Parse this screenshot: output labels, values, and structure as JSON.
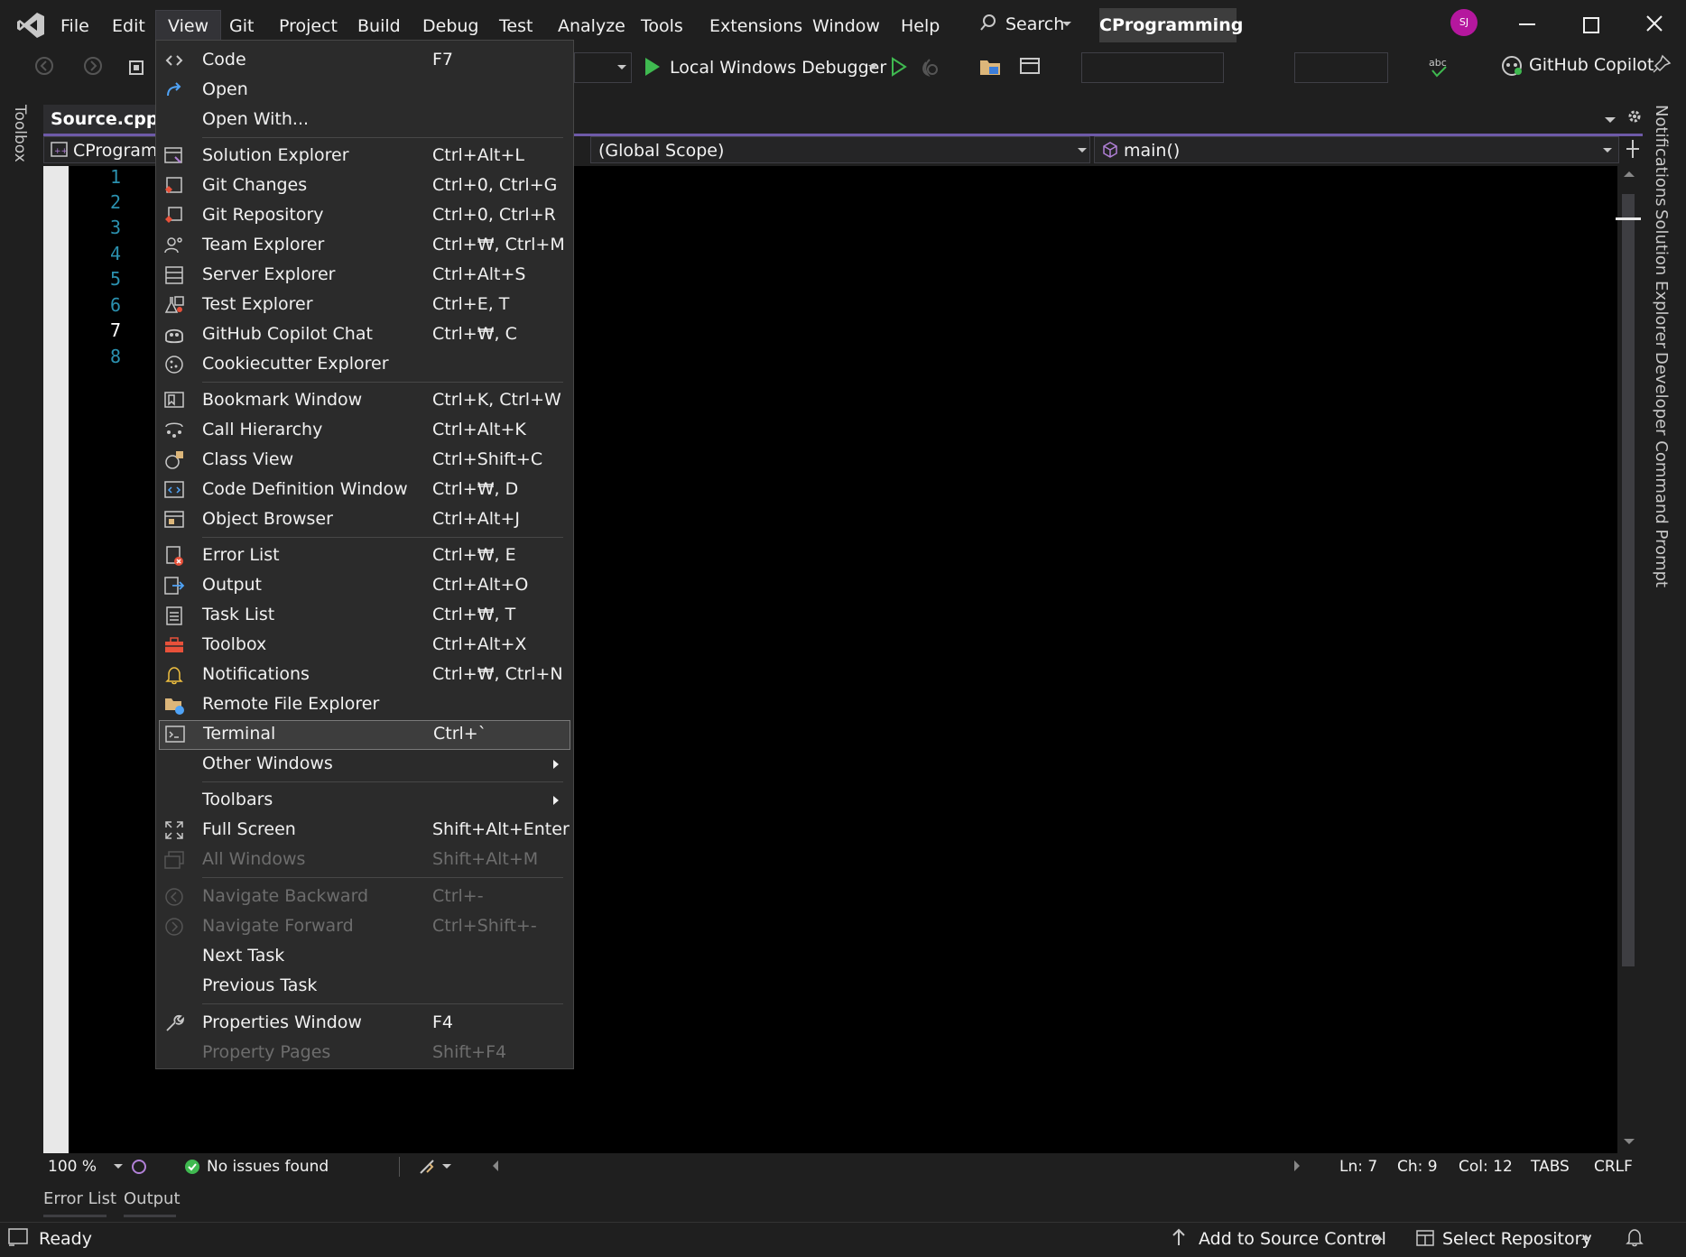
{
  "menubar": {
    "items": [
      "File",
      "Edit",
      "View",
      "Git",
      "Project",
      "Build",
      "Debug",
      "Test",
      "Analyze",
      "Tools",
      "Extensions",
      "Window",
      "Help"
    ],
    "search_label": "Search",
    "solution_name": "CProgramming",
    "avatar_initials": "SJ"
  },
  "toolbar": {
    "debugger_label": "Local Windows Debugger",
    "copilot_label": "GitHub Copilot"
  },
  "toolbox_label": "Toolbox",
  "right_panels": [
    "Notifications",
    "Solution Explorer",
    "Developer Command Prompt"
  ],
  "editor": {
    "tab_label": "Source.cpp",
    "project_combo": "CProgramm",
    "scope_combo": "(Global Scope)",
    "member_combo": "main()",
    "line_numbers": [
      "1",
      "2",
      "3",
      "4",
      "5",
      "6",
      "7",
      "8"
    ],
    "zoom": "100 %",
    "issues": "No issues found",
    "ln": "Ln: 7",
    "ch": "Ch: 9",
    "col": "Col: 12",
    "tabs": "TABS",
    "eol": "CRLF"
  },
  "bottom_tabs": [
    "Error List",
    "Output"
  ],
  "statusbar": {
    "ready": "Ready",
    "add_source_control": "Add to Source Control",
    "select_repository": "Select Repository"
  },
  "view_menu": {
    "items": [
      {
        "label": "Code",
        "shortcut": "F7",
        "icon": "code-icon"
      },
      {
        "label": "Open",
        "shortcut": "",
        "icon": "open-icon"
      },
      {
        "label": "Open With...",
        "shortcut": "",
        "icon": ""
      },
      {
        "label": "Solution Explorer",
        "shortcut": "Ctrl+Alt+L",
        "icon": "solution-explorer-icon"
      },
      {
        "label": "Git Changes",
        "shortcut": "Ctrl+0, Ctrl+G",
        "icon": "git-changes-icon"
      },
      {
        "label": "Git Repository",
        "shortcut": "Ctrl+0, Ctrl+R",
        "icon": "git-repository-icon"
      },
      {
        "label": "Team Explorer",
        "shortcut": "Ctrl+₩, Ctrl+M",
        "icon": "team-explorer-icon"
      },
      {
        "label": "Server Explorer",
        "shortcut": "Ctrl+Alt+S",
        "icon": "server-explorer-icon"
      },
      {
        "label": "Test Explorer",
        "shortcut": "Ctrl+E, T",
        "icon": "test-explorer-icon"
      },
      {
        "label": "GitHub Copilot Chat",
        "shortcut": "Ctrl+₩, C",
        "icon": "copilot-icon"
      },
      {
        "label": "Cookiecutter Explorer",
        "shortcut": "",
        "icon": "cookie-icon"
      },
      {
        "label": "Bookmark Window",
        "shortcut": "Ctrl+K, Ctrl+W",
        "icon": "bookmark-icon"
      },
      {
        "label": "Call Hierarchy",
        "shortcut": "Ctrl+Alt+K",
        "icon": "call-hierarchy-icon"
      },
      {
        "label": "Class View",
        "shortcut": "Ctrl+Shift+C",
        "icon": "class-view-icon"
      },
      {
        "label": "Code Definition Window",
        "shortcut": "Ctrl+₩, D",
        "icon": "code-definition-icon"
      },
      {
        "label": "Object Browser",
        "shortcut": "Ctrl+Alt+J",
        "icon": "object-browser-icon"
      },
      {
        "label": "Error List",
        "shortcut": "Ctrl+₩, E",
        "icon": "error-list-icon"
      },
      {
        "label": "Output",
        "shortcut": "Ctrl+Alt+O",
        "icon": "output-icon"
      },
      {
        "label": "Task List",
        "shortcut": "Ctrl+₩, T",
        "icon": "task-list-icon"
      },
      {
        "label": "Toolbox",
        "shortcut": "Ctrl+Alt+X",
        "icon": "toolbox-icon"
      },
      {
        "label": "Notifications",
        "shortcut": "Ctrl+₩, Ctrl+N",
        "icon": "bell-icon"
      },
      {
        "label": "Remote File Explorer",
        "shortcut": "",
        "icon": "remote-file-icon"
      },
      {
        "label": "Terminal",
        "shortcut": "Ctrl+`",
        "icon": "terminal-icon"
      },
      {
        "label": "Other Windows",
        "shortcut": "",
        "icon": ""
      },
      {
        "label": "Toolbars",
        "shortcut": "",
        "icon": ""
      },
      {
        "label": "Full Screen",
        "shortcut": "Shift+Alt+Enter",
        "icon": "full-screen-icon"
      },
      {
        "label": "All Windows",
        "shortcut": "Shift+Alt+M",
        "icon": "all-windows-icon"
      },
      {
        "label": "Navigate Backward",
        "shortcut": "Ctrl+-",
        "icon": "back-icon"
      },
      {
        "label": "Navigate Forward",
        "shortcut": "Ctrl+Shift+-",
        "icon": "forward-icon"
      },
      {
        "label": "Next Task",
        "shortcut": "",
        "icon": ""
      },
      {
        "label": "Previous Task",
        "shortcut": "",
        "icon": ""
      },
      {
        "label": "Properties Window",
        "shortcut": "F4",
        "icon": "wrench-icon"
      },
      {
        "label": "Property Pages",
        "shortcut": "Shift+F4",
        "icon": ""
      }
    ]
  },
  "colors": {
    "accent": "#6e5aa8",
    "line_number": "#2b91af",
    "play_green": "#3fb950",
    "avatar": "#b5179e"
  }
}
